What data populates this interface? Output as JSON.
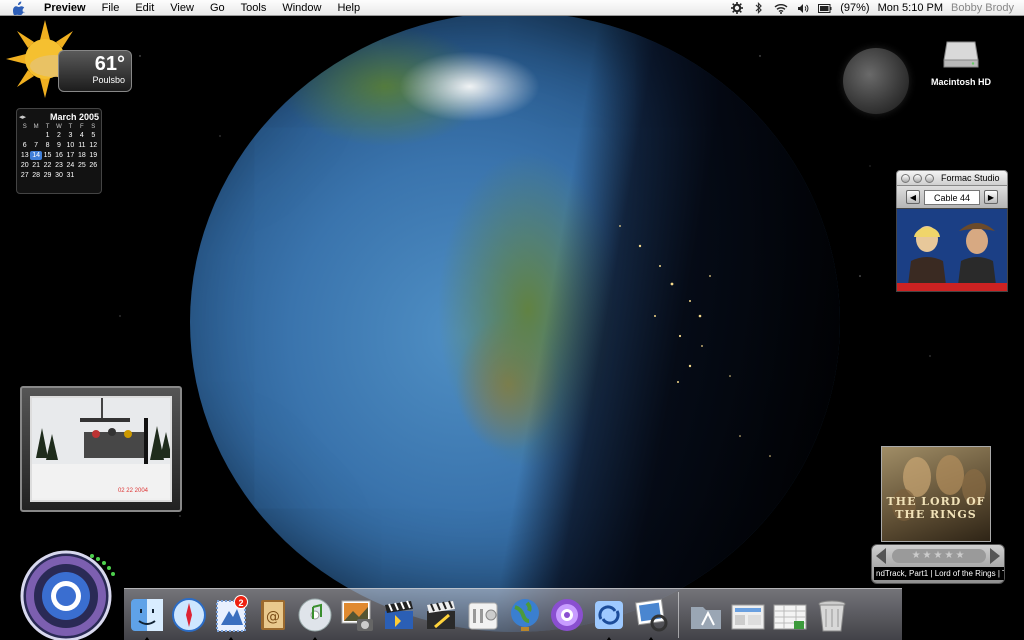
{
  "menubar": {
    "app_name": "Preview",
    "menus": [
      "File",
      "Edit",
      "View",
      "Go",
      "Tools",
      "Window",
      "Help"
    ],
    "battery": "(97%)",
    "clock": "Mon 5:10 PM",
    "user": "Bobby Brody"
  },
  "weather": {
    "temp": "61°",
    "city": "Poulsbo"
  },
  "calendar": {
    "month": "March 2005",
    "nav": "◂▸",
    "day_headers": [
      "S",
      "M",
      "T",
      "W",
      "T",
      "F",
      "S"
    ],
    "cells": [
      "",
      "",
      "1",
      "2",
      "3",
      "4",
      "5",
      "6",
      "7",
      "8",
      "9",
      "10",
      "11",
      "12",
      "13",
      "14",
      "15",
      "16",
      "17",
      "18",
      "19",
      "20",
      "21",
      "22",
      "23",
      "24",
      "25",
      "26",
      "27",
      "28",
      "29",
      "30",
      "31",
      "",
      ""
    ],
    "today": "14"
  },
  "desktop": {
    "hd_label": "Macintosh HD"
  },
  "tv": {
    "title": "Formac Studio",
    "channel": "Cable 44"
  },
  "photo": {
    "timestamp": "02 22 2004"
  },
  "cd": {
    "title": "THE LORD OF THE RINGS"
  },
  "itunes": {
    "stars": "★★★★★",
    "track": "ndTrack, Part1 | Lord of the Rings | The"
  },
  "dock": {
    "mail_badge": "2",
    "items": [
      "finder",
      "safari",
      "mail",
      "address-book",
      "itunes",
      "iphoto",
      "imovie",
      "final-cut",
      "system-prefs",
      "network-globe",
      "dvd-player",
      "sync",
      "photo-booth",
      "applications-folder",
      "documents-stack",
      "recent-stack",
      "trash"
    ]
  },
  "colors": {
    "accent": "#3f7ed8",
    "badge": "#ee2211"
  }
}
